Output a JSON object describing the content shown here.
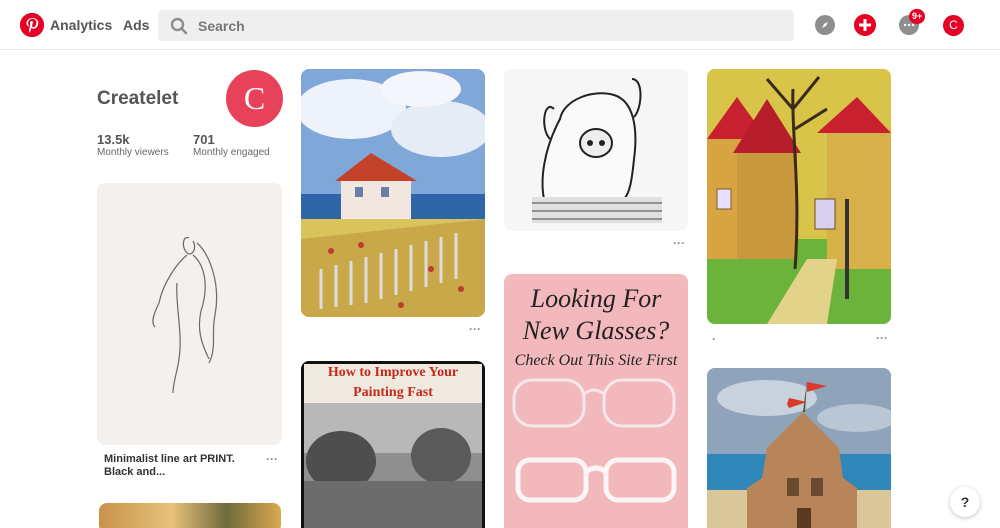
{
  "header": {
    "logo_icon": "pinterest-logo-icon",
    "nav_analytics": "Analytics",
    "nav_ads": "Ads",
    "search_placeholder": "Search",
    "notifications_badge": "9+",
    "user_initial": "C",
    "brand_color": "#e60023"
  },
  "profile": {
    "name": "Createlet",
    "avatar_initial": "C",
    "stats": [
      {
        "value": "13.5k",
        "label": "Monthly viewers"
      },
      {
        "value": "701",
        "label": "Monthly engaged"
      }
    ]
  },
  "pins": {
    "minimalist_caption": "Minimalist line art PRINT. Black and...",
    "glasses_line1": "Looking For",
    "glasses_line2": "New Glasses?",
    "glasses_line3": "Check Out This Site First",
    "painting_line1": "How to Improve Your",
    "painting_line2": "Painting Fast",
    "dots": "···",
    "village_caption": "."
  },
  "help_label": "?"
}
